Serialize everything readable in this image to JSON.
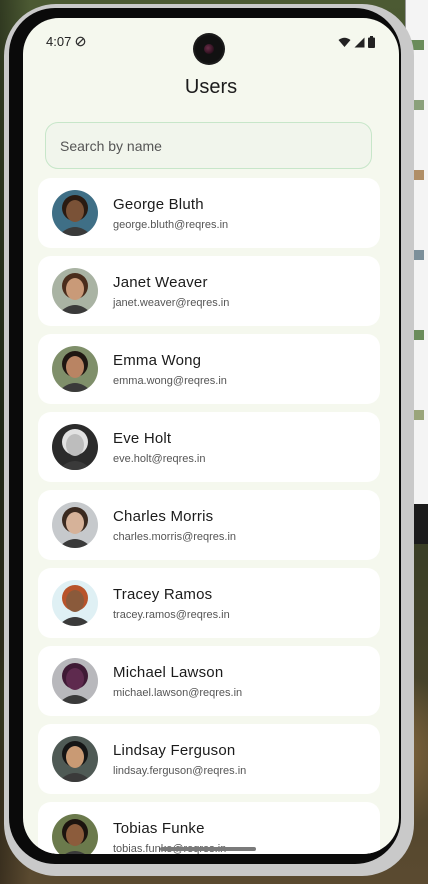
{
  "status_bar": {
    "time": "4:07",
    "icons": [
      "do-not-disturb-icon",
      "wifi-icon",
      "signal-icon",
      "battery-icon"
    ]
  },
  "app": {
    "title": "Users"
  },
  "search": {
    "placeholder": "Search by name",
    "value": ""
  },
  "users": [
    {
      "name": "George Bluth",
      "email": "george.bluth@reqres.in",
      "avatar_bg": "#3f6f86",
      "skin": "#7a5237",
      "hair": "#2a1b12"
    },
    {
      "name": "Janet Weaver",
      "email": "janet.weaver@reqres.in",
      "avatar_bg": "#a9b3a3",
      "skin": "#c99a78",
      "hair": "#4a2d1c"
    },
    {
      "name": "Emma Wong",
      "email": "emma.wong@reqres.in",
      "avatar_bg": "#7f8f6a",
      "skin": "#b98463",
      "hair": "#1f1712"
    },
    {
      "name": "Eve Holt",
      "email": "eve.holt@reqres.in",
      "avatar_bg": "#2b2b2b",
      "skin": "#bdbdbd",
      "hair": "#e2e2e2"
    },
    {
      "name": "Charles Morris",
      "email": "charles.morris@reqres.in",
      "avatar_bg": "#c6c9cc",
      "skin": "#d6b299",
      "hair": "#3b2a20"
    },
    {
      "name": "Tracey Ramos",
      "email": "tracey.ramos@reqres.in",
      "avatar_bg": "#dff0f4",
      "skin": "#8a5a3b",
      "hair": "#b8532a"
    },
    {
      "name": "Michael Lawson",
      "email": "michael.lawson@reqres.in",
      "avatar_bg": "#b8b8bc",
      "skin": "#5e2a4e",
      "hair": "#3f1a35"
    },
    {
      "name": "Lindsay Ferguson",
      "email": "lindsay.ferguson@reqres.in",
      "avatar_bg": "#4f5a55",
      "skin": "#c99a74",
      "hair": "#151515"
    },
    {
      "name": "Tobias Funke",
      "email": "tobias.funke@reqres.in",
      "avatar_bg": "#6b7a4c",
      "skin": "#8c5c3c",
      "hair": "#1c140f"
    }
  ]
}
